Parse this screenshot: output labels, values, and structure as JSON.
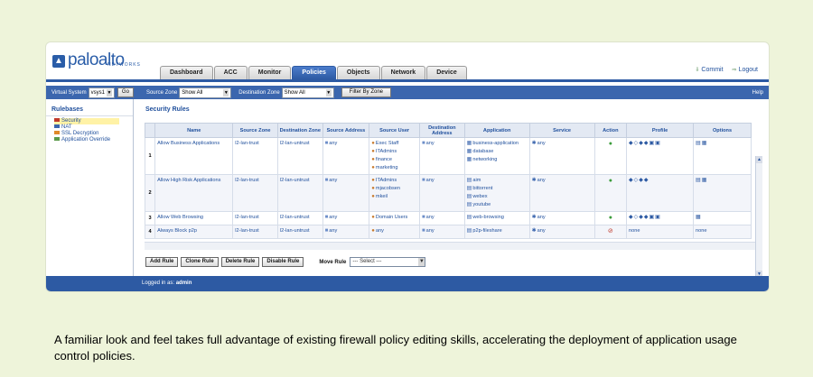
{
  "brand": {
    "logo_main": "paloalto",
    "logo_sub": "NETWORKS"
  },
  "tabs": [
    "Dashboard",
    "ACC",
    "Monitor",
    "Policies",
    "Objects",
    "Network",
    "Device"
  ],
  "active_tab": "Policies",
  "top_links": {
    "commit": "Commit",
    "logout": "Logout"
  },
  "filter_bar": {
    "vsys_label": "Virtual System",
    "vsys_value": "vsys1",
    "go": "Go",
    "source_zone_label": "Source Zone",
    "source_zone_value": "Show All",
    "dest_zone_label": "Destination Zone",
    "dest_zone_value": "Show All",
    "filter_btn": "Filter By Zone",
    "help": "Help"
  },
  "sidebar": {
    "title": "Rulebases",
    "items": [
      "Security",
      "NAT",
      "SSL Decryption",
      "Application Override"
    ]
  },
  "main": {
    "title": "Security Rules",
    "columns": [
      "Name",
      "Source Zone",
      "Destination Zone",
      "Source Address",
      "Source User",
      "Destination Address",
      "Application",
      "Service",
      "Action",
      "Profile",
      "Options"
    ],
    "rows": [
      {
        "num": "1",
        "name": "Allow Business Applications",
        "src_zone": "l2-lan-trust",
        "dst_zone": "l2-lan-untrust",
        "src_addr": "any",
        "users": [
          "Exec Staff",
          "ITAdmins",
          "finance",
          "marketing"
        ],
        "dst_addr": "any",
        "apps": [
          "business-application",
          "database",
          "networking"
        ],
        "service": "any",
        "action": "allow",
        "profile": "",
        "options": ""
      },
      {
        "num": "2",
        "name": "Allow High Risk Applications",
        "src_zone": "l2-lan-trust",
        "dst_zone": "l2-lan-untrust",
        "src_addr": "any",
        "users": [
          "ITAdmins",
          "mjacobsen",
          "mkeil"
        ],
        "dst_addr": "any",
        "apps": [
          "aim",
          "bittorrent",
          "webex",
          "youtube"
        ],
        "service": "any",
        "action": "allow",
        "profile": "",
        "options": ""
      },
      {
        "num": "3",
        "name": "Allow Web Browsing",
        "src_zone": "l2-lan-trust",
        "dst_zone": "l2-lan-untrust",
        "src_addr": "any",
        "users": [
          "Domain Users"
        ],
        "dst_addr": "any",
        "apps": [
          "web-browsing"
        ],
        "service": "any",
        "action": "allow",
        "profile": "",
        "options": ""
      },
      {
        "num": "4",
        "name": "Always Block p2p",
        "src_zone": "l2-lan-trust",
        "dst_zone": "l2-lan-untrust",
        "src_addr": "any",
        "users": [
          "any"
        ],
        "dst_addr": "any",
        "apps": [
          "p2p-fileshare"
        ],
        "service": "any",
        "action": "deny",
        "profile": "none",
        "options": "none"
      }
    ]
  },
  "buttons": {
    "add": "Add Rule",
    "clone": "Clone Rule",
    "delete": "Delete Rule",
    "disable": "Disable Rule",
    "move_label": "Move Rule",
    "move_select": "--- Select ---"
  },
  "status": {
    "logged_in_label": "Logged in as:",
    "user": "admin"
  },
  "caption": "A familiar look and feel takes full advantage of existing firewall policy editing skills, accelerating the deployment of application usage control policies.",
  "colors": {
    "brand_blue": "#2d5aa3",
    "background": "#eef4da",
    "allow": "#3c9d3c",
    "deny": "#c0392b"
  }
}
